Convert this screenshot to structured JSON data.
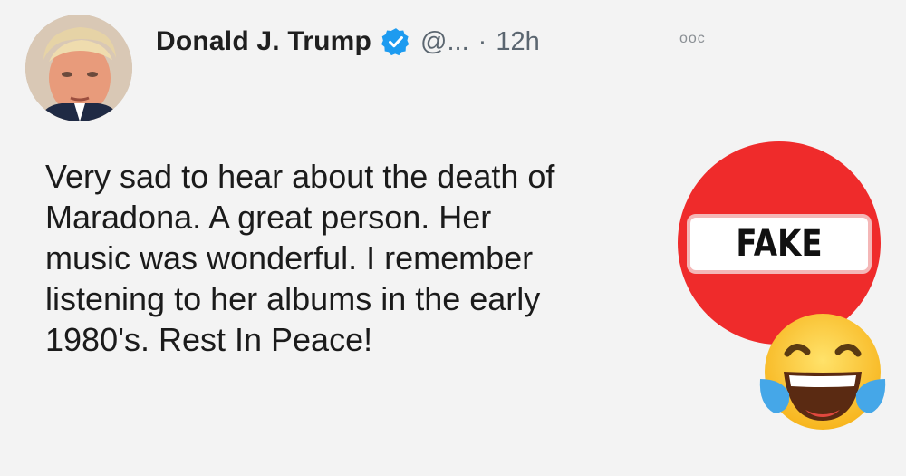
{
  "tweet": {
    "author_name": "Donald J. Trump",
    "handle": "@...",
    "separator": "·",
    "time": "12h",
    "more_menu": "ooc",
    "text_lines": [
      "Very sad to hear about the death of",
      "Maradona. A great person. Her",
      "music was wonderful. I remember",
      "listening to her albums in the early",
      "1980's. Rest In Peace!"
    ]
  },
  "overlay": {
    "stamp_label": "FAKE",
    "stamp_color": "#ef2b2b",
    "emoji": "face-with-tears-of-joy"
  },
  "colors": {
    "verified_badge": "#1d9bf0",
    "background": "#f3f3f3"
  }
}
